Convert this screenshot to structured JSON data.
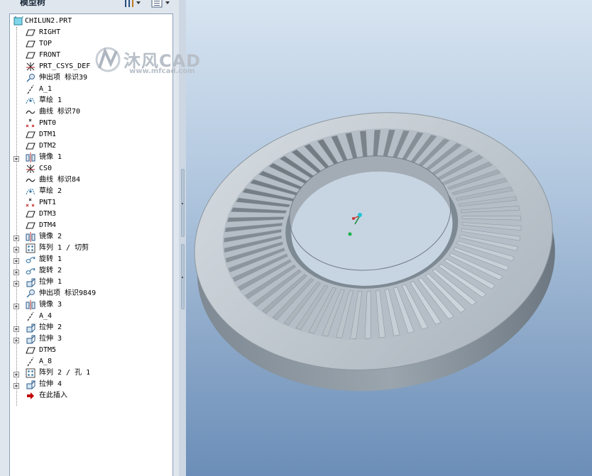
{
  "panel": {
    "title": "模型树"
  },
  "tree": {
    "root": "CHILUN2.PRT",
    "items": [
      {
        "label": "RIGHT",
        "icon": "datum-plane-icon",
        "expand": false
      },
      {
        "label": "TOP",
        "icon": "datum-plane-icon",
        "expand": false
      },
      {
        "label": "FRONT",
        "icon": "datum-plane-icon",
        "expand": false
      },
      {
        "label": "PRT_CSYS_DEF",
        "icon": "coordinate-system-icon",
        "expand": false
      },
      {
        "label": "伸出项 标识39",
        "icon": "protrusion-icon",
        "expand": false
      },
      {
        "label": "A_1",
        "icon": "datum-axis-icon",
        "expand": false
      },
      {
        "label": "草绘 1",
        "icon": "sketch-icon",
        "expand": false
      },
      {
        "label": "曲线 标识70",
        "icon": "curve-icon",
        "expand": false
      },
      {
        "label": "PNT0",
        "icon": "datum-point-icon",
        "expand": false
      },
      {
        "label": "DTM1",
        "icon": "datum-plane-icon",
        "expand": false
      },
      {
        "label": "DTM2",
        "icon": "datum-plane-icon",
        "expand": false
      },
      {
        "label": "镜像 1",
        "icon": "mirror-icon",
        "expand": true
      },
      {
        "label": "CS0",
        "icon": "coordinate-system-icon",
        "expand": false
      },
      {
        "label": "曲线 标识84",
        "icon": "curve-icon",
        "expand": false
      },
      {
        "label": "草绘 2",
        "icon": "sketch-icon",
        "expand": false
      },
      {
        "label": "PNT1",
        "icon": "datum-point-icon",
        "expand": false
      },
      {
        "label": "DTM3",
        "icon": "datum-plane-icon",
        "expand": false
      },
      {
        "label": "DTM4",
        "icon": "datum-plane-icon",
        "expand": false
      },
      {
        "label": "镜像 2",
        "icon": "mirror-icon",
        "expand": true
      },
      {
        "label": "阵列 1 / 切剪",
        "icon": "pattern-icon",
        "expand": true
      },
      {
        "label": "旋转 1",
        "icon": "revolve-icon",
        "expand": true
      },
      {
        "label": "旋转 2",
        "icon": "revolve-icon",
        "expand": true
      },
      {
        "label": "拉伸 1",
        "icon": "extrude-icon",
        "expand": true
      },
      {
        "label": "伸出项 标识9849",
        "icon": "protrusion-icon",
        "expand": false
      },
      {
        "label": "镜像 3",
        "icon": "mirror-icon",
        "expand": true
      },
      {
        "label": "A_4",
        "icon": "datum-axis-icon",
        "expand": false
      },
      {
        "label": "拉伸 2",
        "icon": "extrude-icon",
        "expand": true
      },
      {
        "label": "拉伸 3",
        "icon": "extrude-icon",
        "expand": true
      },
      {
        "label": "DTM5",
        "icon": "datum-plane-icon",
        "expand": false
      },
      {
        "label": "A_8",
        "icon": "datum-axis-icon",
        "expand": false
      },
      {
        "label": "阵列 2 / 孔 1",
        "icon": "pattern-icon",
        "expand": true
      },
      {
        "label": "拉伸 4",
        "icon": "extrude-icon",
        "expand": true
      },
      {
        "label": "在此插入",
        "icon": "insert-here-arrow-icon",
        "expand": false
      }
    ]
  },
  "watermark": {
    "brand": "沐风CAD",
    "url": "www.mfcad.com"
  },
  "colors": {
    "tree_bg": "#ffffff",
    "viewport_top": "#d7e4f1",
    "viewport_bottom": "#6b8eb8",
    "gear": "#b9c3cc",
    "insert_arrow": "#c00000"
  }
}
